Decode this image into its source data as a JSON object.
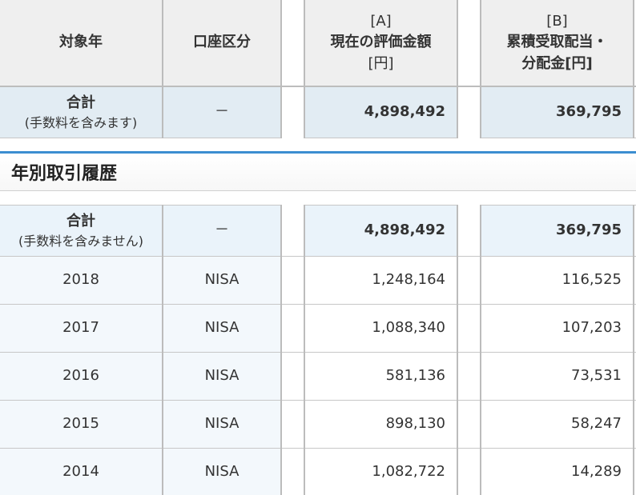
{
  "top_table": {
    "headers": {
      "year": "対象年",
      "account": "口座区分",
      "a_prefix": "[A]",
      "a_label": "現在の評価金額",
      "a_unit": "[円]",
      "b_prefix": "[B]",
      "b_label": "累積受取配当・",
      "b_label2": "分配金[円]"
    },
    "total_row": {
      "label": "合計",
      "note": "(手数料を含みます)",
      "account": "－",
      "a": "4,898,492",
      "b": "369,795"
    }
  },
  "section": {
    "title": "年別取引履歴"
  },
  "history_table": {
    "total_row": {
      "label": "合計",
      "note": "(手数料を含みません)",
      "account": "－",
      "a": "4,898,492",
      "b": "369,795"
    },
    "rows": [
      {
        "year": "2018",
        "account": "NISA",
        "a": "1,248,164",
        "b": "116,525"
      },
      {
        "year": "2017",
        "account": "NISA",
        "a": "1,088,340",
        "b": "107,203"
      },
      {
        "year": "2016",
        "account": "NISA",
        "a": "581,136",
        "b": "73,531"
      },
      {
        "year": "2015",
        "account": "NISA",
        "a": "898,130",
        "b": "58,247"
      },
      {
        "year": "2014",
        "account": "NISA",
        "a": "1,082,722",
        "b": "14,289"
      }
    ]
  }
}
